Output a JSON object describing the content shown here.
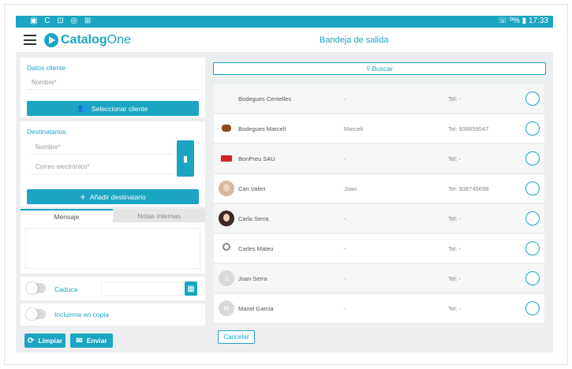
{
  "status_bar": {
    "left_icons": "▣ C ⊡ ◎ ⊞",
    "right": "☏ ᵇ% ▮ 17:33"
  },
  "app_bar": {
    "brand_bold": "Catalog",
    "brand_light": "One",
    "title": "Bandeja de salida"
  },
  "client": {
    "section_label": "Datos cliente",
    "name_placeholder": "Nombre*",
    "select_button": "Seleccionar cliente"
  },
  "recipients": {
    "section_label": "Destinatarios",
    "name_placeholder": "Nombre*",
    "email_placeholder": "Correo electrónico*",
    "add_button": "Añadir destinatario"
  },
  "message_tabs": [
    {
      "label": "Mensaje"
    },
    {
      "label": "Notas internas"
    }
  ],
  "expires": {
    "label": "Caduca"
  },
  "include_me": {
    "label": "Incluirme en copia"
  },
  "actions": {
    "clear": "Limpiar",
    "send": "Enviar",
    "cancel": "Cancelar"
  },
  "search": {
    "label": "Buscar"
  },
  "clients": [
    {
      "name": "Bodegues Centelles",
      "contact": "-",
      "tel": "Tel: -",
      "avatar": "none"
    },
    {
      "name": "Bodegues Marcelí",
      "contact": "Marcelí",
      "tel": "Tel: 938659547",
      "avatar": "product"
    },
    {
      "name": "BonPreu SAU",
      "contact": "-",
      "tel": "Tel: -",
      "avatar": "logo"
    },
    {
      "name": "Can Valeri",
      "contact": "Joan",
      "tel": "Tel: 938745698",
      "avatar": "photo"
    },
    {
      "name": "Carla Serra",
      "contact": "-",
      "tel": "Tel: -",
      "avatar": "photo-woman"
    },
    {
      "name": "Carles Mateu",
      "contact": "-",
      "tel": "Tel: -",
      "avatar": "ribbon"
    },
    {
      "name": "Joan Serra",
      "contact": "-",
      "tel": "Tel: -",
      "avatar": "initial",
      "initial": "J"
    },
    {
      "name": "Manel Garcia",
      "contact": "-",
      "tel": "Tel: -",
      "avatar": "initial",
      "initial": "M"
    }
  ],
  "colors": {
    "accent": "#1ba5c3",
    "background": "#eceeef"
  }
}
